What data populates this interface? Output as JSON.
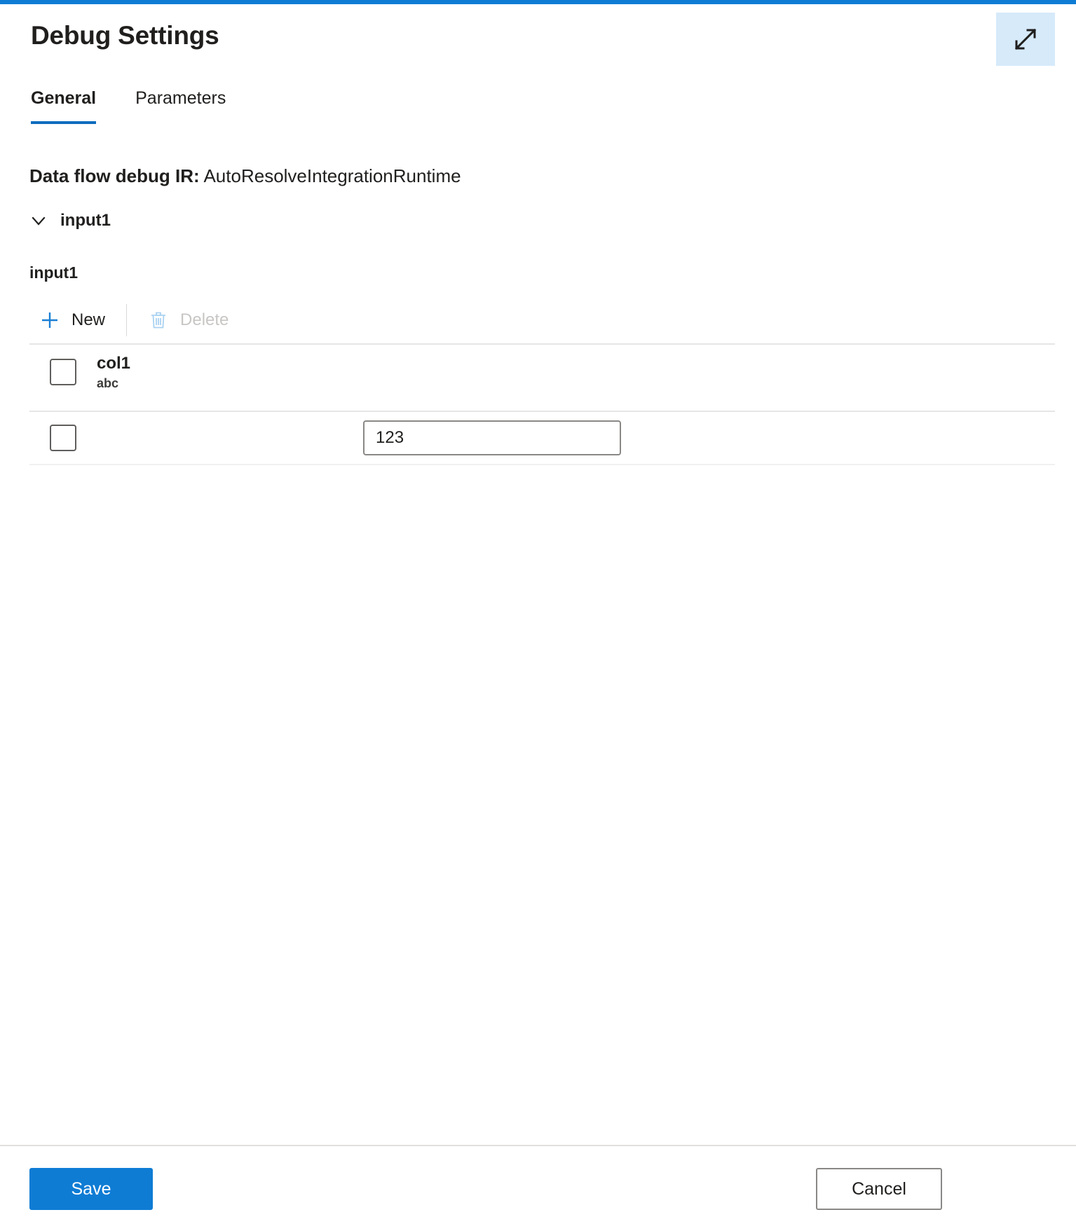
{
  "window": {
    "title": "Debug Settings",
    "accent_color": "#0f7cd4"
  },
  "header": {
    "expand_icon": "expand-diagonal-arrows-icon",
    "expand_tooltip": "Expand"
  },
  "tabs": [
    {
      "label": "General",
      "active": true
    },
    {
      "label": "Parameters",
      "active": false
    }
  ],
  "general": {
    "ir_label": "Data flow debug IR:",
    "ir_value": "AutoResolveIntegrationRuntime",
    "section": {
      "chevron_icon": "chevron-down-icon",
      "label": "input1",
      "expanded": true
    },
    "stream_name": "input1",
    "command_bar": {
      "new": {
        "label": "New",
        "icon": "plus-icon",
        "enabled": true
      },
      "delete": {
        "label": "Delete",
        "icon": "trash-icon",
        "enabled": false
      }
    },
    "table": {
      "columns": [
        {
          "name": "col1",
          "type": "abc"
        }
      ],
      "header_checkbox_checked": false,
      "rows": [
        {
          "checked": false,
          "values": [
            "123"
          ]
        }
      ]
    }
  },
  "footer": {
    "save_label": "Save",
    "cancel_label": "Cancel"
  }
}
